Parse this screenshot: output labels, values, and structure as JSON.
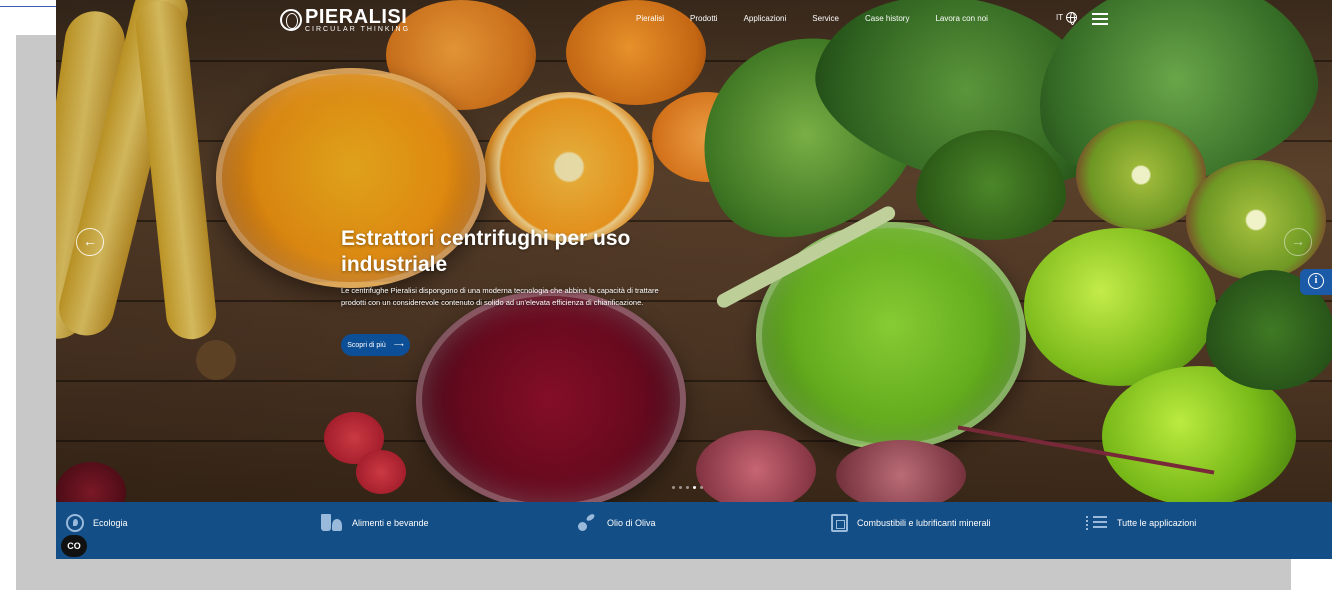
{
  "header": {
    "logo": {
      "name": "PIERALISI",
      "tagline": "CIRCULAR THINKING"
    },
    "nav": [
      "Pieralisi",
      "Prodotti",
      "Applicazioni",
      "Service",
      "Case history",
      "Lavora con noi"
    ],
    "language": "IT"
  },
  "slider": {
    "title": "Estrattori centrifughi per uso industriale",
    "description": "Le centrifughe Pieralisi dispongono di una moderna tecnologia che abbina la capacità di trattare prodotti con un considerevole contenuto di solido ad un'elevata efficienza di chiarificazione.",
    "cta_label": "Scopri di più",
    "cta_arrow": "⟶",
    "prev_arrow": "←",
    "next_arrow": "→",
    "slide_count": 5,
    "active_slide": 4
  },
  "categories": [
    {
      "label": "Ecologia",
      "icon": "ecology-icon"
    },
    {
      "label": "Alimenti e bevande",
      "icon": "food-beverage-icon"
    },
    {
      "label": "Olio di Oliva",
      "icon": "olive-oil-icon"
    },
    {
      "label": "Combustibili e lubrificanti minerali",
      "icon": "fuel-icon"
    },
    {
      "label": "Tutte le applicazioni",
      "icon": "list-icon"
    }
  ],
  "accessibility_badge": "CO",
  "colors": {
    "accent": "#134e86",
    "cta": "#0d4f96",
    "info": "#1a5aa6"
  }
}
